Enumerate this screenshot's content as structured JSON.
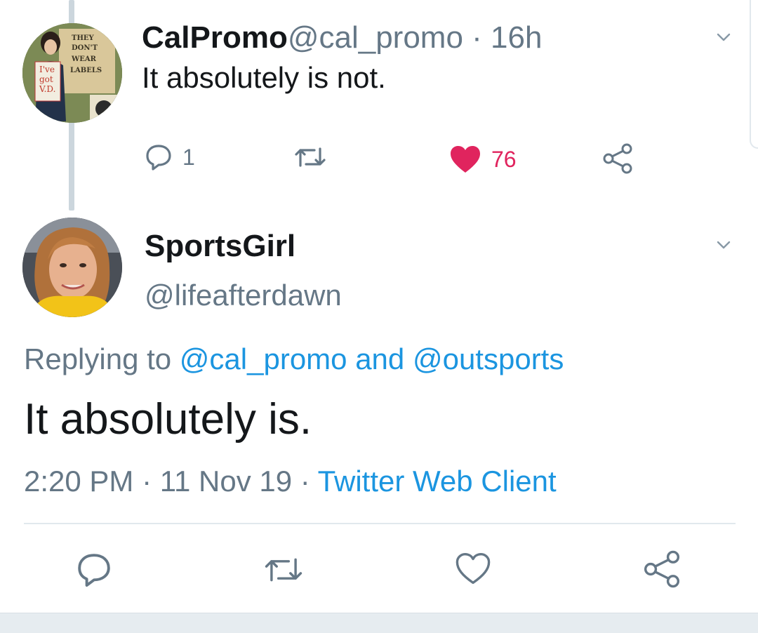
{
  "tweet1": {
    "display_name": "CalPromo",
    "handle": "@cal_promo",
    "separator": " · ",
    "time": "16h",
    "text": "It absolutely is not.",
    "reply_count": "1",
    "like_count": "76",
    "avatar_text": [
      "THEY",
      "DON'T",
      "WEAR",
      "LABELS",
      "I've",
      "got",
      "V.D."
    ]
  },
  "tweet2": {
    "display_name": "SportsGirl",
    "handle": "@lifeafterdawn",
    "replying_prefix": "Replying to ",
    "mention1": "@cal_promo",
    "and": " and ",
    "mention2": "@outsports",
    "text": "It absolutely is.",
    "time": "2:20 PM",
    "dot": " · ",
    "date": "11 Nov 19",
    "client": "Twitter Web Client"
  },
  "colors": {
    "accent": "#1b95e0",
    "like": "#e0245e",
    "muted": "#657786",
    "text": "#14171a"
  },
  "icons": [
    "reply-icon",
    "retweet-icon",
    "like-icon",
    "share-icon",
    "chevron-down-icon"
  ]
}
